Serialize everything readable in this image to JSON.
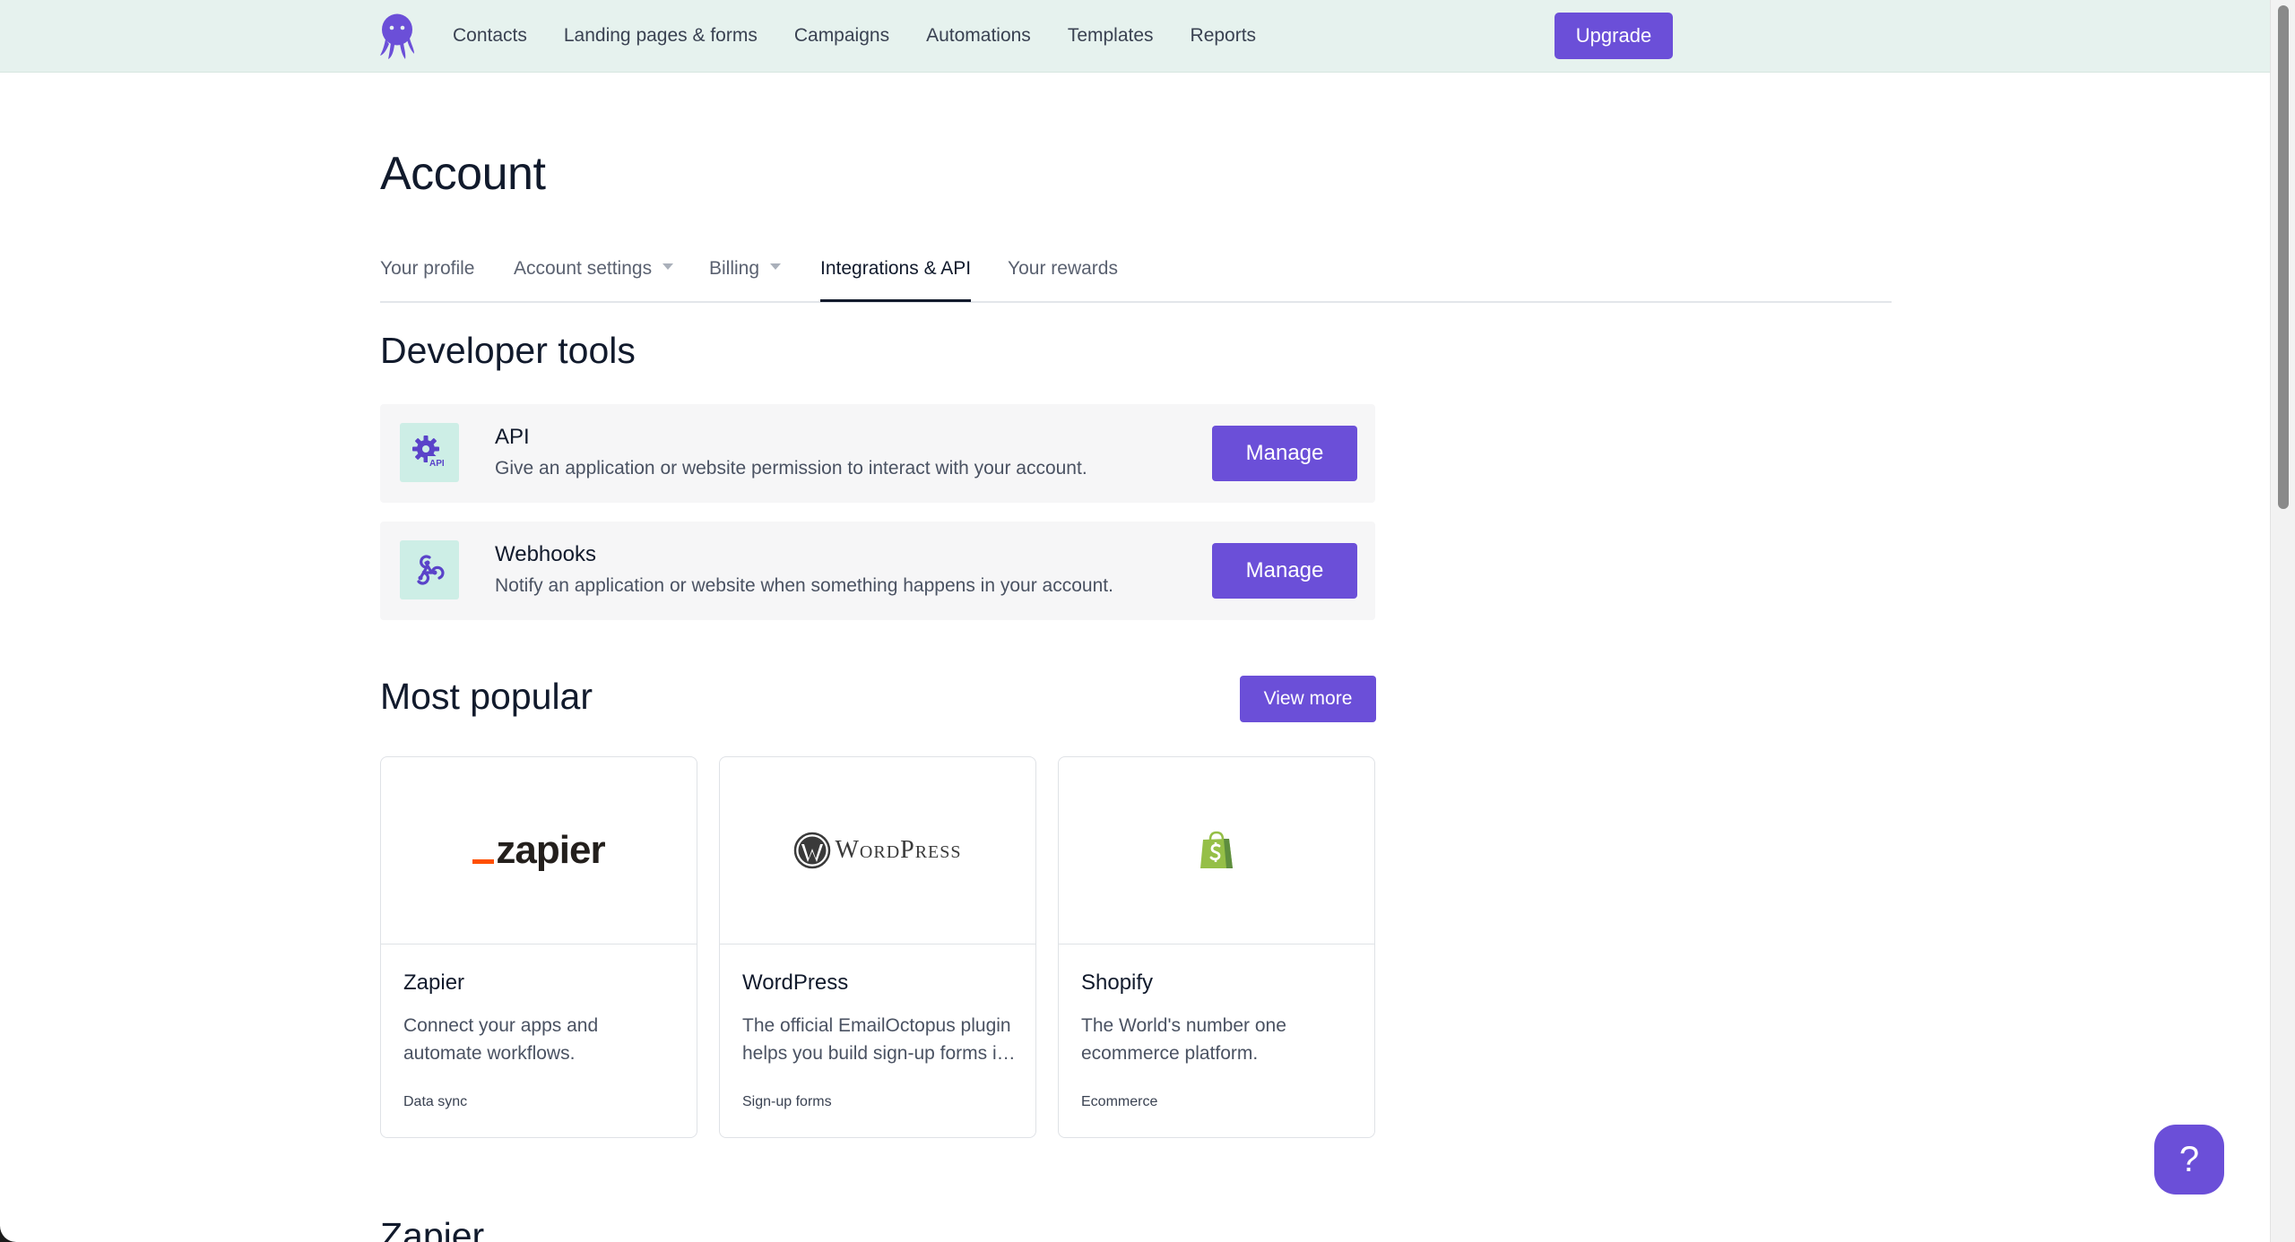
{
  "nav": {
    "links": [
      "Contacts",
      "Landing pages & forms",
      "Campaigns",
      "Automations",
      "Templates",
      "Reports"
    ],
    "upgrade_label": "Upgrade"
  },
  "page": {
    "title": "Account"
  },
  "tabs": [
    {
      "label": "Your profile",
      "has_dropdown": false,
      "active": false
    },
    {
      "label": "Account settings",
      "has_dropdown": true,
      "active": false
    },
    {
      "label": "Billing",
      "has_dropdown": true,
      "active": false
    },
    {
      "label": "Integrations & API",
      "has_dropdown": false,
      "active": true
    },
    {
      "label": "Your rewards",
      "has_dropdown": false,
      "active": false
    }
  ],
  "developer_tools": {
    "title": "Developer tools",
    "items": [
      {
        "name": "API",
        "description": "Give an application or website permission to interact with your account.",
        "button": "Manage",
        "icon": "api-gear-icon"
      },
      {
        "name": "Webhooks",
        "description": "Notify an application or website when something happens in your account.",
        "button": "Manage",
        "icon": "webhooks-icon"
      }
    ]
  },
  "most_popular": {
    "title": "Most popular",
    "view_more_label": "View more",
    "items": [
      {
        "name": "Zapier",
        "description": "Connect your apps and automate workflows.",
        "category": "Data sync",
        "logo_text": "zapier"
      },
      {
        "name": "WordPress",
        "description": "The official EmailOctopus plugin helps you build sign-up forms in your WordPress site.",
        "category": "Sign-up forms",
        "logo_text": "WordPress"
      },
      {
        "name": "Shopify",
        "description": "The World's number one ecommerce platform.",
        "category": "Ecommerce",
        "logo_text": ""
      }
    ]
  },
  "next_section": {
    "title": "Zapier"
  },
  "help": {
    "label": "?"
  },
  "colors": {
    "accent": "#6b4fd8",
    "nav_bg": "#e6f2ee",
    "icon_bg": "#cdeee6",
    "zapier_orange": "#ff4f00",
    "shopify_green": "#95bf47"
  }
}
